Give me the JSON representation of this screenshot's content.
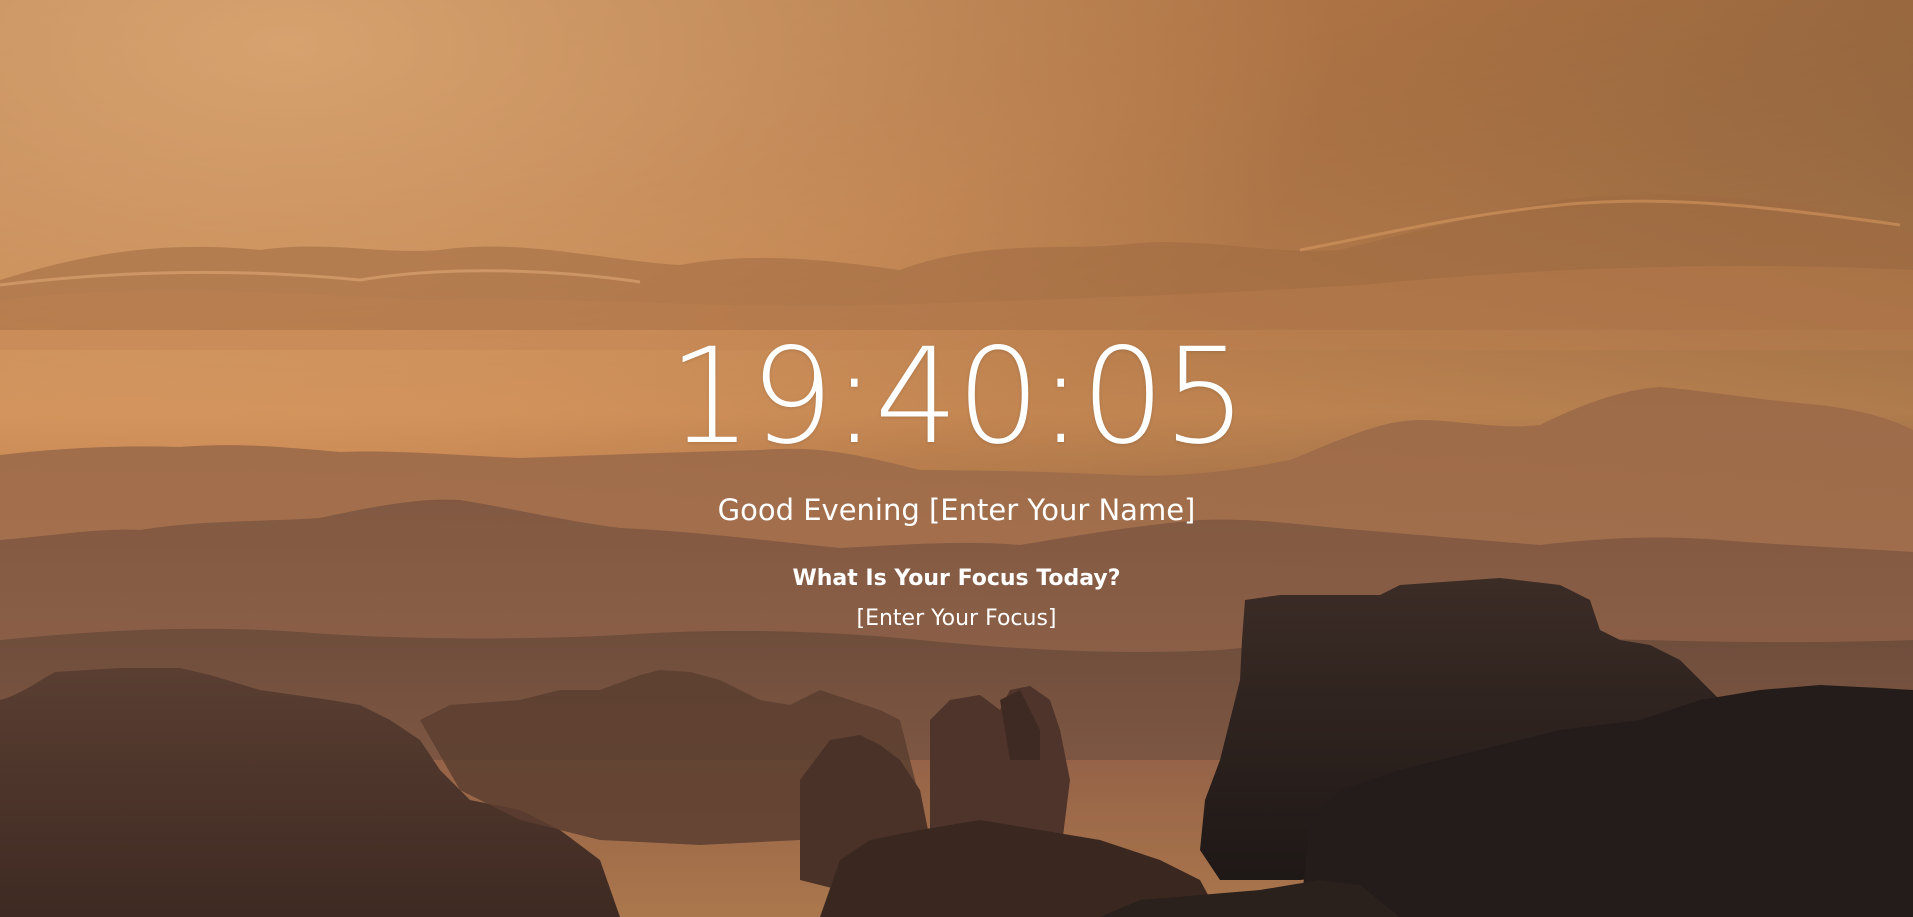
{
  "clock": {
    "time": "19:40:05"
  },
  "greeting": {
    "prefix": "Good Evening",
    "name": "[Enter Your Name]"
  },
  "focus": {
    "question": "What Is Your Focus Today?",
    "value": "[Enter Your Focus]"
  },
  "colors": {
    "sky_top": "#b07a4a",
    "sky_mid": "#d89058",
    "haze": "#c07a4c",
    "rock_dark": "#2a201d",
    "text": "#ffffff"
  }
}
